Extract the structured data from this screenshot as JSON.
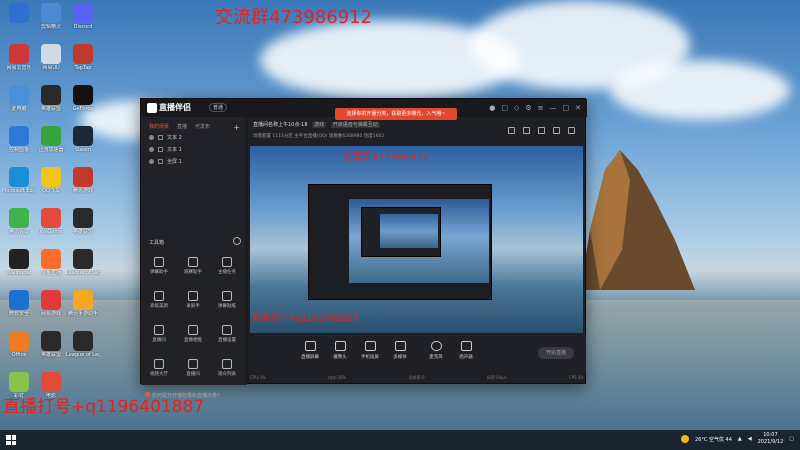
{
  "overlay": {
    "top_text": "交流群473986912",
    "bottom_text": "直播打号+q1196401887"
  },
  "desktop_icons": [
    {
      "label": "",
      "color": "#2f6fd1"
    },
    {
      "label": "剪辑精灵",
      "color": "#4c8ad6"
    },
    {
      "label": "Discord",
      "color": "#5865f2"
    },
    {
      "label": "网易云音乐",
      "color": "#d03737"
    },
    {
      "label": "网易UU",
      "color": "#d0dbe8"
    },
    {
      "label": "TapTap",
      "color": "#c0392b"
    },
    {
      "label": "此电脑",
      "color": "#4a90d9"
    },
    {
      "label": "英雄联盟",
      "color": "#2a2a2a"
    },
    {
      "label": "GeForce",
      "color": "#111111"
    },
    {
      "label": "控制面板",
      "color": "#2b7bd6"
    },
    {
      "label": "迅游加速器",
      "color": "#36a33c"
    },
    {
      "label": "Steam",
      "color": "#1b2838"
    },
    {
      "label": "Microsoft Edge",
      "color": "#1a8fd8"
    },
    {
      "label": "QQ飞车",
      "color": "#f0c419"
    },
    {
      "label": "腾讯游戏",
      "color": "#c0392b"
    },
    {
      "label": "腾讯会议",
      "color": "#3fb24b"
    },
    {
      "label": "WeGame",
      "color": "#e14b3c"
    },
    {
      "label": "英雄联盟",
      "color": "#2a2a2a"
    },
    {
      "label": "Wallpaper",
      "color": "#222222"
    },
    {
      "label": "斗鱼直播",
      "color": "#ff6c2c"
    },
    {
      "label": "League of Legends",
      "color": "#2a2a2a"
    },
    {
      "label": "微软安全",
      "color": "#1d6fd3"
    },
    {
      "label": "网易游戏",
      "color": "#e13a3a"
    },
    {
      "label": "腾讯手游助手",
      "color": "#f5a623"
    },
    {
      "label": "Office",
      "color": "#f07a26"
    },
    {
      "label": "英雄联盟",
      "color": "#2a2a2a"
    },
    {
      "label": "League of Legends",
      "color": "#2a2a2a"
    },
    {
      "label": "彩虹",
      "color": "#8bc34a"
    },
    {
      "label": "电影",
      "color": "#e14b3c"
    }
  ],
  "app": {
    "logo": "直播伴侣",
    "badge": "普通",
    "promo": "选择你的开播分类，获取更多曝光，入气哦~",
    "tabs": [
      "我的场景",
      "直播",
      "可发布"
    ],
    "scenes": [
      "文本 2",
      "文本 1",
      "全屏 1"
    ],
    "live_title": "直播间名称上午10点-18",
    "live_tag": "游戏",
    "live_hint": "开启语音与弹幕互动",
    "info_line": "场景配置  1111分区  主平台直播(QQ)  观看数6268980  热度1602",
    "tools_header": "工具箱",
    "tools": [
      "弹幕助手",
      "观赛助手",
      "主播任务",
      "高级美颜",
      "录屏手",
      "弹幕贴纸",
      "直播间",
      "直播相框",
      "直播设置",
      "视频大厅",
      "直播间",
      "观众列表"
    ],
    "preview_text": "交流群473986912",
    "preview_text2": "直播打号+q1196401887",
    "bottom_tools": [
      "直播屏幕",
      "摄像头",
      "手机投屏",
      "多媒体",
      "麦克风",
      "扬声器"
    ],
    "start_button": "开始直播",
    "footer_hint": "如何提升开播效果和直播流量？",
    "status_items": [
      "CPU:3%",
      "内存:26%",
      "丢帧率:0",
      "码率:0kb/s",
      "FPS:30"
    ]
  },
  "taskbar": {
    "weather": "26°C 空气优 44",
    "time": "10:07",
    "date": "2021/9/12"
  }
}
